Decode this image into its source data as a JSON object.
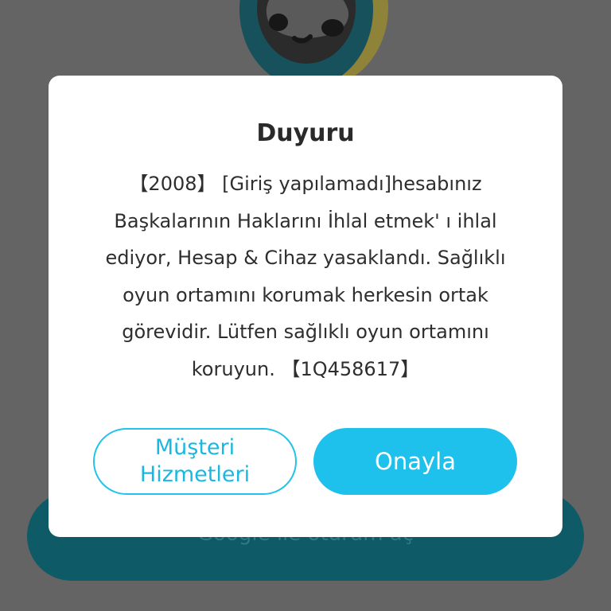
{
  "background": {
    "login_button_label": "Google ile oturum aç",
    "colors": {
      "overlay": "#646464",
      "login_button": "#0e5a66"
    }
  },
  "dialog": {
    "title": "Duyuru",
    "message_lines": [
      "【2008】 [Giriş yapılamadı]hesabınız",
      "Başkalarının Haklarını İhlal etmek' ı ihlal",
      "ediyor, Hesap & Cihaz yasaklandı. Sağlıklı",
      "oyun ortamını korumak herkesin ortak",
      "görevidir. Lütfen sağlıklı oyun ortamını",
      "koruyun. 【1Q458617】"
    ],
    "buttons": {
      "support_line1": "Müşteri",
      "support_line2": "Hizmetleri",
      "confirm": "Onayla"
    },
    "colors": {
      "accent": "#1ec0ec",
      "text": "#2e2e2e"
    }
  },
  "icons": {
    "mascot": "mascot-icon"
  }
}
